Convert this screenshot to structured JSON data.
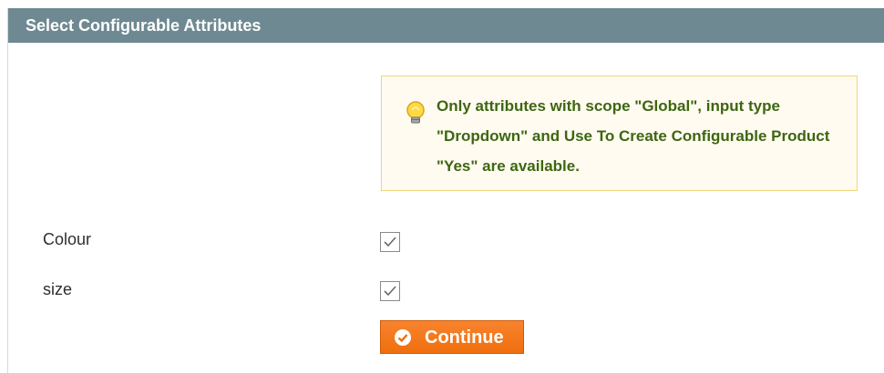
{
  "section": {
    "title": "Select Configurable Attributes"
  },
  "notice": {
    "text": "Only attributes with scope \"Global\", input type \"Dropdown\" and Use To Create Configurable Product \"Yes\" are available."
  },
  "attributes": [
    {
      "label": "Colour",
      "checked": true
    },
    {
      "label": "size",
      "checked": true
    }
  ],
  "actions": {
    "continue_label": "Continue"
  },
  "colors": {
    "header_bg": "#6f8992",
    "notice_text": "#3d6611",
    "notice_bg": "#fffbf0",
    "notice_border": "#eed67a",
    "button_bg": "#f47a1f"
  },
  "icons": {
    "notice": "lightbulb-icon",
    "button": "check-circle-icon",
    "checkbox": "checkmark-icon"
  }
}
